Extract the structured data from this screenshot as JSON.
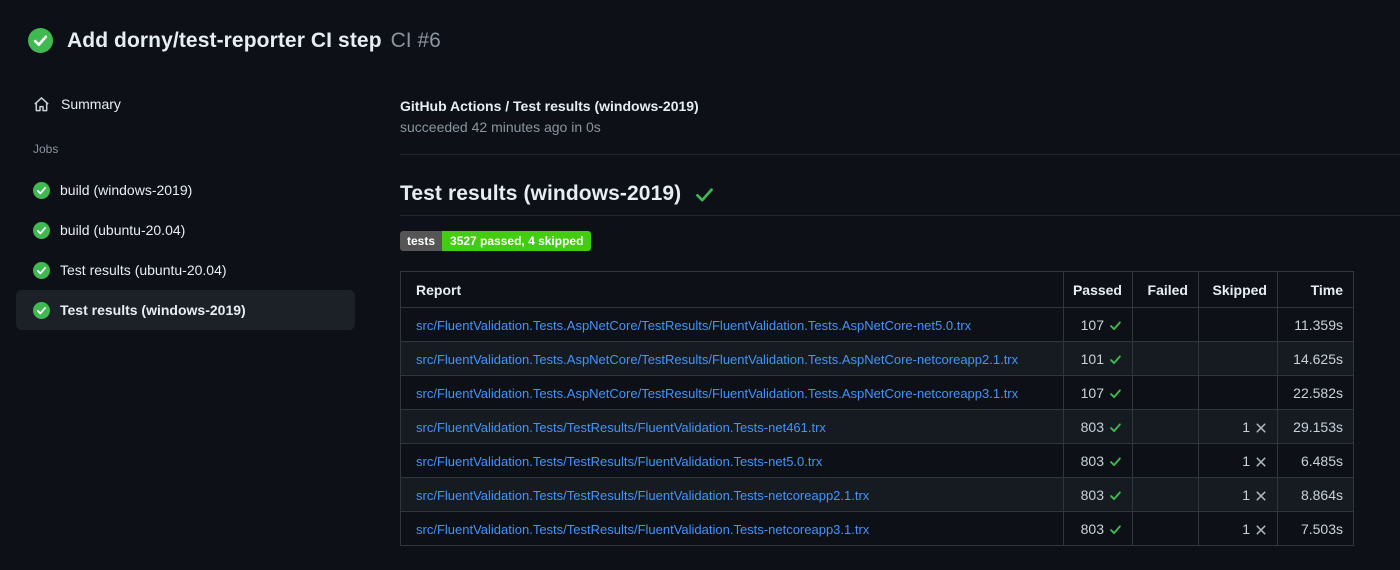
{
  "page": {
    "title": "Add dorny/test-reporter CI step",
    "run_number": "CI #6"
  },
  "sidebar": {
    "summary_label": "Summary",
    "jobs_label": "Jobs",
    "jobs": [
      {
        "label": "build (windows-2019)",
        "status": "success",
        "selected": false
      },
      {
        "label": "build (ubuntu-20.04)",
        "status": "success",
        "selected": false
      },
      {
        "label": "Test results (ubuntu-20.04)",
        "status": "success",
        "selected": false
      },
      {
        "label": "Test results (windows-2019)",
        "status": "success",
        "selected": true
      }
    ]
  },
  "main": {
    "job_header": {
      "title": "GitHub Actions / Test results (windows-2019)",
      "status_line": "succeeded 42 minutes ago in 0s"
    },
    "section_heading": "Test results (windows-2019)",
    "badge": {
      "label": "tests",
      "value": "3527 passed, 4 skipped",
      "label_bg": "#555555",
      "value_bg": "#44cc11"
    },
    "table": {
      "columns": [
        "Report",
        "Passed",
        "Failed",
        "Skipped",
        "Time"
      ],
      "rows": [
        {
          "report": "src/FluentValidation.Tests.AspNetCore/TestResults/FluentValidation.Tests.AspNetCore-net5.0.trx",
          "passed": "107",
          "failed": "",
          "skipped": "",
          "time": "11.359s"
        },
        {
          "report": "src/FluentValidation.Tests.AspNetCore/TestResults/FluentValidation.Tests.AspNetCore-netcoreapp2.1.trx",
          "passed": "101",
          "failed": "",
          "skipped": "",
          "time": "14.625s"
        },
        {
          "report": "src/FluentValidation.Tests.AspNetCore/TestResults/FluentValidation.Tests.AspNetCore-netcoreapp3.1.trx",
          "passed": "107",
          "failed": "",
          "skipped": "",
          "time": "22.582s"
        },
        {
          "report": "src/FluentValidation.Tests/TestResults/FluentValidation.Tests-net461.trx",
          "passed": "803",
          "failed": "",
          "skipped": "1",
          "time": "29.153s"
        },
        {
          "report": "src/FluentValidation.Tests/TestResults/FluentValidation.Tests-net5.0.trx",
          "passed": "803",
          "failed": "",
          "skipped": "1",
          "time": "6.485s"
        },
        {
          "report": "src/FluentValidation.Tests/TestResults/FluentValidation.Tests-netcoreapp2.1.trx",
          "passed": "803",
          "failed": "",
          "skipped": "1",
          "time": "8.864s"
        },
        {
          "report": "src/FluentValidation.Tests/TestResults/FluentValidation.Tests-netcoreapp3.1.trx",
          "passed": "803",
          "failed": "",
          "skipped": "1",
          "time": "7.503s"
        }
      ]
    }
  },
  "colors": {
    "background": "#0d1117",
    "success_green": "#3fb950",
    "link_blue": "#4493f8",
    "secondary_text": "#8b949e",
    "table_border": "#30363d",
    "row_alt": "#161b22",
    "selected_item_bg": "#1c2128",
    "skipped_x": "#afb8c1"
  }
}
